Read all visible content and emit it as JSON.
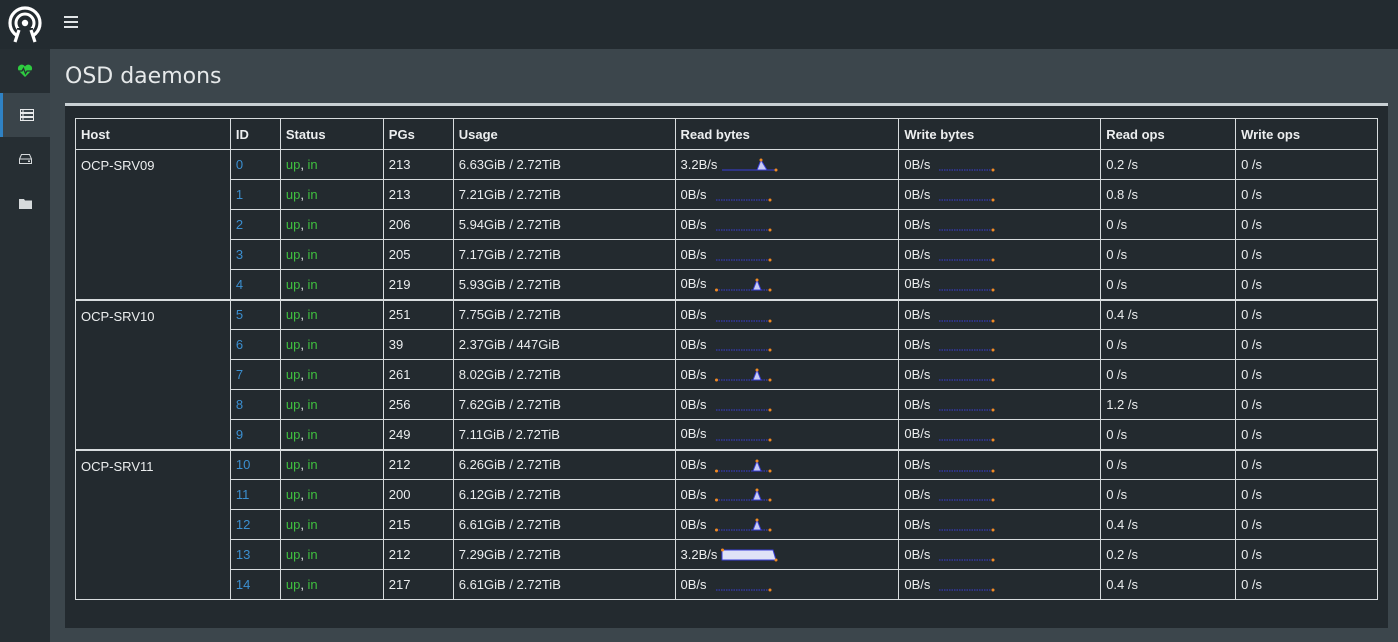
{
  "page": {
    "title": "OSD daemons"
  },
  "navigation": {
    "logo_icon": "ceph-logo-icon",
    "menu_icon": "hamburger-icon",
    "sidebar": [
      {
        "name": "health",
        "icon": "heartbeat-icon",
        "color": "#2ecc40",
        "active": false
      },
      {
        "name": "servers",
        "icon": "server-list-icon",
        "active": true
      },
      {
        "name": "block",
        "icon": "hard-drive-icon",
        "active": false
      },
      {
        "name": "filesystem",
        "icon": "folder-icon",
        "active": false
      }
    ]
  },
  "colors": {
    "link": "#3b8fd0",
    "status_ok": "#3fbf3f",
    "sparkline": "#3a3fd8",
    "sparkline_point": "#f08a24"
  },
  "table": {
    "columns": [
      "Host",
      "ID",
      "Status",
      "PGs",
      "Usage",
      "Read bytes",
      "Write bytes",
      "Read ops",
      "Write ops"
    ],
    "rows": [
      {
        "host": "OCP-SRV09",
        "id": "0",
        "status_up": "up",
        "status_in": "in",
        "pgs": "213",
        "usage": "6.63GiB / 2.72TiB",
        "read_bytes": "3.2B/s",
        "read_spark": "spike-end",
        "write_bytes": "0B/s",
        "write_spark": "flat",
        "read_ops": "0.2 /s",
        "write_ops": "0 /s"
      },
      {
        "host": "",
        "id": "1",
        "status_up": "up",
        "status_in": "in",
        "pgs": "213",
        "usage": "7.21GiB / 2.72TiB",
        "read_bytes": "0B/s",
        "read_spark": "flat",
        "write_bytes": "0B/s",
        "write_spark": "flat",
        "read_ops": "0.8 /s",
        "write_ops": "0 /s"
      },
      {
        "host": "",
        "id": "2",
        "status_up": "up",
        "status_in": "in",
        "pgs": "206",
        "usage": "5.94GiB / 2.72TiB",
        "read_bytes": "0B/s",
        "read_spark": "flat",
        "write_bytes": "0B/s",
        "write_spark": "flat",
        "read_ops": "0 /s",
        "write_ops": "0 /s"
      },
      {
        "host": "",
        "id": "3",
        "status_up": "up",
        "status_in": "in",
        "pgs": "205",
        "usage": "7.17GiB / 2.72TiB",
        "read_bytes": "0B/s",
        "read_spark": "flat",
        "write_bytes": "0B/s",
        "write_spark": "flat",
        "read_ops": "0 /s",
        "write_ops": "0 /s"
      },
      {
        "host": "",
        "id": "4",
        "status_up": "up",
        "status_in": "in",
        "pgs": "219",
        "usage": "5.93GiB / 2.72TiB",
        "read_bytes": "0B/s",
        "read_spark": "spike",
        "write_bytes": "0B/s",
        "write_spark": "flat",
        "read_ops": "0 /s",
        "write_ops": "0 /s"
      },
      {
        "host": "OCP-SRV10",
        "id": "5",
        "status_up": "up",
        "status_in": "in",
        "pgs": "251",
        "usage": "7.75GiB / 2.72TiB",
        "read_bytes": "0B/s",
        "read_spark": "flat",
        "write_bytes": "0B/s",
        "write_spark": "flat",
        "read_ops": "0.4 /s",
        "write_ops": "0 /s"
      },
      {
        "host": "",
        "id": "6",
        "status_up": "up",
        "status_in": "in",
        "pgs": "39",
        "usage": "2.37GiB / 447GiB",
        "read_bytes": "0B/s",
        "read_spark": "flat",
        "write_bytes": "0B/s",
        "write_spark": "flat",
        "read_ops": "0 /s",
        "write_ops": "0 /s"
      },
      {
        "host": "",
        "id": "7",
        "status_up": "up",
        "status_in": "in",
        "pgs": "261",
        "usage": "8.02GiB / 2.72TiB",
        "read_bytes": "0B/s",
        "read_spark": "spike",
        "write_bytes": "0B/s",
        "write_spark": "flat",
        "read_ops": "0 /s",
        "write_ops": "0 /s"
      },
      {
        "host": "",
        "id": "8",
        "status_up": "up",
        "status_in": "in",
        "pgs": "256",
        "usage": "7.62GiB / 2.72TiB",
        "read_bytes": "0B/s",
        "read_spark": "flat",
        "write_bytes": "0B/s",
        "write_spark": "flat",
        "read_ops": "1.2 /s",
        "write_ops": "0 /s"
      },
      {
        "host": "",
        "id": "9",
        "status_up": "up",
        "status_in": "in",
        "pgs": "249",
        "usage": "7.11GiB / 2.72TiB",
        "read_bytes": "0B/s",
        "read_spark": "flat",
        "write_bytes": "0B/s",
        "write_spark": "flat",
        "read_ops": "0 /s",
        "write_ops": "0 /s"
      },
      {
        "host": "OCP-SRV11",
        "id": "10",
        "status_up": "up",
        "status_in": "in",
        "pgs": "212",
        "usage": "6.26GiB / 2.72TiB",
        "read_bytes": "0B/s",
        "read_spark": "spike",
        "write_bytes": "0B/s",
        "write_spark": "flat",
        "read_ops": "0 /s",
        "write_ops": "0 /s"
      },
      {
        "host": "",
        "id": "11",
        "status_up": "up",
        "status_in": "in",
        "pgs": "200",
        "usage": "6.12GiB / 2.72TiB",
        "read_bytes": "0B/s",
        "read_spark": "spike",
        "write_bytes": "0B/s",
        "write_spark": "flat",
        "read_ops": "0 /s",
        "write_ops": "0 /s"
      },
      {
        "host": "",
        "id": "12",
        "status_up": "up",
        "status_in": "in",
        "pgs": "215",
        "usage": "6.61GiB / 2.72TiB",
        "read_bytes": "0B/s",
        "read_spark": "spike",
        "write_bytes": "0B/s",
        "write_spark": "flat",
        "read_ops": "0.4 /s",
        "write_ops": "0 /s"
      },
      {
        "host": "",
        "id": "13",
        "status_up": "up",
        "status_in": "in",
        "pgs": "212",
        "usage": "7.29GiB / 2.72TiB",
        "read_bytes": "3.2B/s",
        "read_spark": "plateau",
        "write_bytes": "0B/s",
        "write_spark": "flat",
        "read_ops": "0.2 /s",
        "write_ops": "0 /s"
      },
      {
        "host": "",
        "id": "14",
        "status_up": "up",
        "status_in": "in",
        "pgs": "217",
        "usage": "6.61GiB / 2.72TiB",
        "read_bytes": "0B/s",
        "read_spark": "flat",
        "write_bytes": "0B/s",
        "write_spark": "flat",
        "read_ops": "0.4 /s",
        "write_ops": "0 /s"
      }
    ]
  }
}
